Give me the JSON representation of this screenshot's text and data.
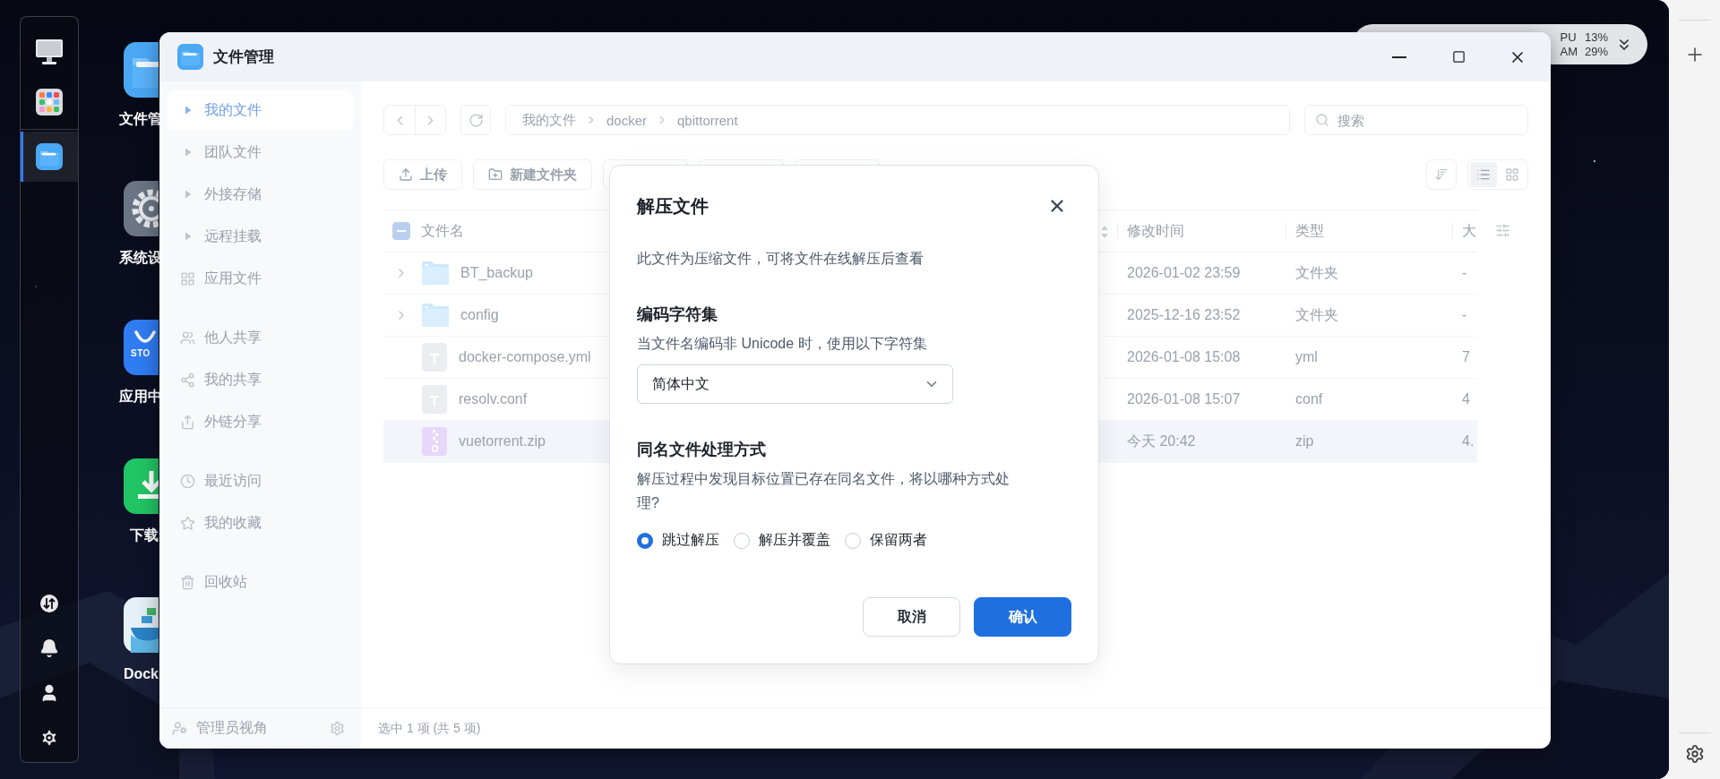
{
  "dock": {
    "items": [
      {
        "kind": "monitor",
        "selected": false
      },
      {
        "kind": "apps",
        "selected": false
      },
      {
        "kind": "files",
        "selected": true
      }
    ],
    "bottom": [
      {
        "kind": "transfer"
      },
      {
        "kind": "bell"
      },
      {
        "kind": "user"
      },
      {
        "kind": "settings"
      }
    ]
  },
  "desktop_icons": [
    {
      "kind": "files",
      "label": "文件管"
    },
    {
      "kind": "settings",
      "label": "系统设"
    },
    {
      "kind": "store",
      "label": "应用中",
      "badge": "STO"
    },
    {
      "kind": "download",
      "label": "下载"
    },
    {
      "kind": "docker",
      "label": "Dock"
    }
  ],
  "widget": {
    "rows": [
      {
        "label": "PU",
        "value": "13%"
      },
      {
        "label": "AM",
        "value": "29%"
      }
    ]
  },
  "window": {
    "title": "文件管理",
    "sidebar": {
      "groups": [
        [
          {
            "kind": "caret",
            "label": "我的文件",
            "selected": true
          },
          {
            "kind": "caret",
            "label": "团队文件",
            "selected": false
          },
          {
            "kind": "caret",
            "label": "外接存储",
            "selected": false
          },
          {
            "kind": "caret",
            "label": "远程挂载",
            "selected": false
          },
          {
            "kind": "grid",
            "label": "应用文件",
            "selected": false
          }
        ],
        [
          {
            "kind": "users",
            "label": "他人共享",
            "selected": false
          },
          {
            "kind": "share",
            "label": "我的共享",
            "selected": false
          },
          {
            "kind": "link",
            "label": "外链分享",
            "selected": false
          }
        ],
        [
          {
            "kind": "clock",
            "label": "最近访问",
            "selected": false
          },
          {
            "kind": "star",
            "label": "我的收藏",
            "selected": false
          }
        ],
        [
          {
            "kind": "trash",
            "label": "回收站",
            "selected": false
          }
        ]
      ],
      "footer": "管理员视角"
    },
    "breadcrumb": [
      "我的文件",
      "docker",
      "qbittorrent"
    ],
    "search": {
      "placeholder": "搜索"
    },
    "actions": [
      {
        "kind": "upload",
        "label": "上传"
      },
      {
        "kind": "new-folder",
        "label": "新建文件夹"
      }
    ],
    "view_modes": [
      {
        "kind": "list",
        "selected": true
      },
      {
        "kind": "grid",
        "selected": false
      }
    ],
    "table": {
      "select_all_indeterminate": true,
      "columns": [
        "文件名",
        "修改时间",
        "类型",
        "大"
      ],
      "rows": [
        {
          "kind": "folder",
          "name": "BT_backup",
          "modified": "2026-01-02 23:59",
          "type": "文件夹",
          "size": "-",
          "selected": false
        },
        {
          "kind": "folder",
          "name": "config",
          "modified": "2025-12-16 23:52",
          "type": "文件夹",
          "size": "-",
          "selected": false
        },
        {
          "kind": "text",
          "name": "docker-compose.yml",
          "modified": "2026-01-08 15:08",
          "type": "yml",
          "size": "7",
          "selected": false
        },
        {
          "kind": "text",
          "name": "resolv.conf",
          "modified": "2026-01-08 15:07",
          "type": "conf",
          "size": "4",
          "selected": false
        },
        {
          "kind": "zip",
          "name": "vuetorrent.zip",
          "modified": "今天 20:42",
          "type": "zip",
          "size": "4.",
          "selected": true
        }
      ]
    },
    "status_bar": "选中 1 项 (共 5 项)"
  },
  "dialog": {
    "title": "解压文件",
    "description": "此文件为压缩文件，可将文件在线解压后查看",
    "encoding": {
      "heading": "编码字符集",
      "hint": "当文件名编码非 Unicode 时，使用以下字符集",
      "value": "简体中文"
    },
    "conflict": {
      "heading": "同名文件处理方式",
      "hint": "解压过程中发现目标位置已存在同名文件，将以哪种方式处理?",
      "options": [
        {
          "label": "跳过解压",
          "selected": true
        },
        {
          "label": "解压并覆盖",
          "selected": false
        },
        {
          "label": "保留两者",
          "selected": false
        }
      ]
    },
    "buttons": [
      {
        "kind": "secondary",
        "label": "取消"
      },
      {
        "kind": "primary",
        "label": "确认"
      }
    ]
  }
}
